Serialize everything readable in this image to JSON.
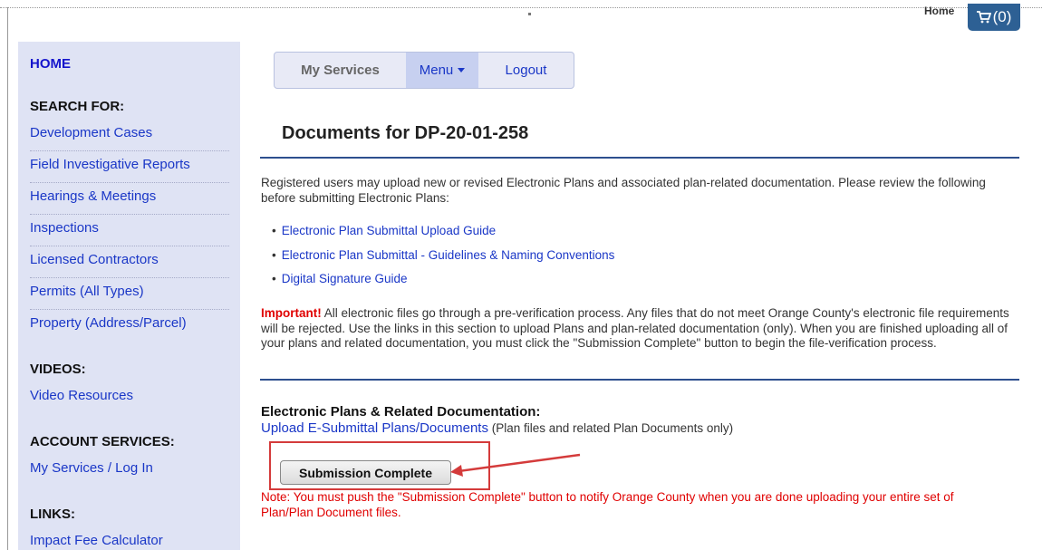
{
  "header": {
    "home_link": "Home",
    "cart_count": "(0)",
    "cart_icon": "shopping-cart-icon"
  },
  "sidebar": {
    "home": "HOME",
    "search_heading": "SEARCH FOR:",
    "search_items": [
      "Development Cases",
      "Field Investigative Reports",
      "Hearings & Meetings",
      "Inspections",
      "Licensed Contractors",
      "Permits (All Types)",
      "Property (Address/Parcel)"
    ],
    "videos_heading": "VIDEOS:",
    "videos_items": [
      "Video Resources"
    ],
    "account_heading": "ACCOUNT SERVICES:",
    "account_items": [
      "My Services / Log In"
    ],
    "links_heading": "LINKS:",
    "links_items": [
      "Impact Fee Calculator"
    ]
  },
  "nav": {
    "my_services": "My Services",
    "menu": "Menu",
    "logout": "Logout"
  },
  "main": {
    "title": "Documents for DP-20-01-258",
    "intro": "Registered users may upload new or revised Electronic Plans and associated plan-related documentation. Please review the following before submitting Electronic Plans:",
    "guides": [
      "Electronic Plan Submittal Upload Guide",
      "Electronic Plan Submittal - Guidelines & Naming Conventions",
      "Digital Signature Guide"
    ],
    "important_label": "Important!",
    "important_text": " All electronic files go through a pre-verification process. Any files that do not meet Orange County's electronic file requirements will be rejected. Use the links in this section to upload Plans and plan-related documentation (only). When you are finished uploading all of your plans and related documentation, you must click the \"Submission Complete\" button to begin the file-verification process.",
    "section_heading": "Electronic Plans & Related Documentation:",
    "upload_link": "Upload E-Submittal Plans/Documents",
    "upload_note": " (Plan files and related Plan Documents only)",
    "submit_button": "Submission Complete",
    "note": "Note: You must push the \"Submission Complete\" button to notify Orange County when you are done uploading your entire set of Plan/Plan Document files."
  },
  "colors": {
    "sidebar_bg": "#dfe3f4",
    "link": "#1a37c7",
    "alert": "#e00000",
    "annotation": "#d43b3b",
    "rule": "#2d4f8e"
  }
}
